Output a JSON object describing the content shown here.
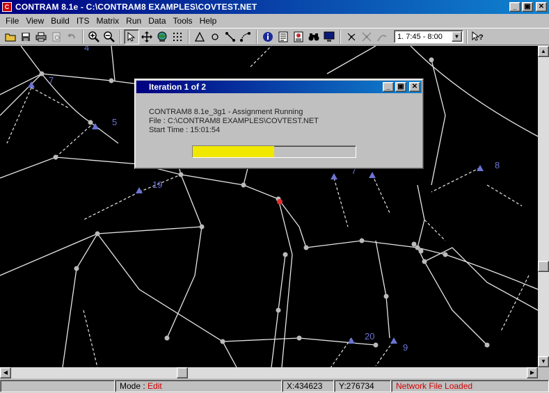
{
  "window": {
    "title": "CONTRAM 8.1e - C:\\CONTRAM8 EXAMPLES\\COVTEST.NET",
    "app_icon_glyph": "C",
    "minimize_glyph": "_",
    "maximize_glyph": "▣",
    "close_glyph": "✕"
  },
  "menu": [
    "File",
    "View",
    "Build",
    "ITS",
    "Matrix",
    "Run",
    "Data",
    "Tools",
    "Help"
  ],
  "toolbar": {
    "icons": [
      "open-folder-icon",
      "save-icon",
      "print-icon",
      "print-preview-icon",
      "undo-icon",
      "zoom-in-icon",
      "zoom-out-icon",
      "select-arrow-icon",
      "pan-icon",
      "globe-icon",
      "grid-icon",
      "triangle-icon",
      "circle-icon",
      "link-icon",
      "node-link-icon",
      "info-icon",
      "document-icon",
      "report-icon",
      "binoculars-icon",
      "monitor-icon",
      "network-icon",
      "junction-icon",
      "route-icon",
      "help-pointer-icon"
    ],
    "time_period": "1.   7:45 -  8:00",
    "dropdown_arrow": "▼"
  },
  "map": {
    "background": "#000000",
    "link_color": "#e6e6e6",
    "node_color": "#bbbbbb",
    "zone_color": "#6a74d4",
    "highlight_node_color": "#e03030",
    "zone_labels": [
      "4",
      "7",
      "5",
      "19",
      "7",
      "8",
      "20",
      "9"
    ]
  },
  "dialog": {
    "title": "Iteration  1 of  2",
    "line1": "CONTRAM8  8.1e_3g1 - Assignment Running",
    "line2": "File : C:\\CONTRAM8 EXAMPLES\\COVTEST.NET",
    "line3": "Start Time : 15:01:54",
    "progress": 0.5,
    "progress_color": "#f0e800"
  },
  "scrollbars": {
    "up_arrow": "▲",
    "down_arrow": "▼",
    "left_arrow": "◀",
    "right_arrow": "▶"
  },
  "statusbar": {
    "mode_label": "Mode :",
    "mode_value": "Edit",
    "x_coord": "X:434623",
    "y_coord": "Y:276734",
    "message": "Network File Loaded"
  }
}
